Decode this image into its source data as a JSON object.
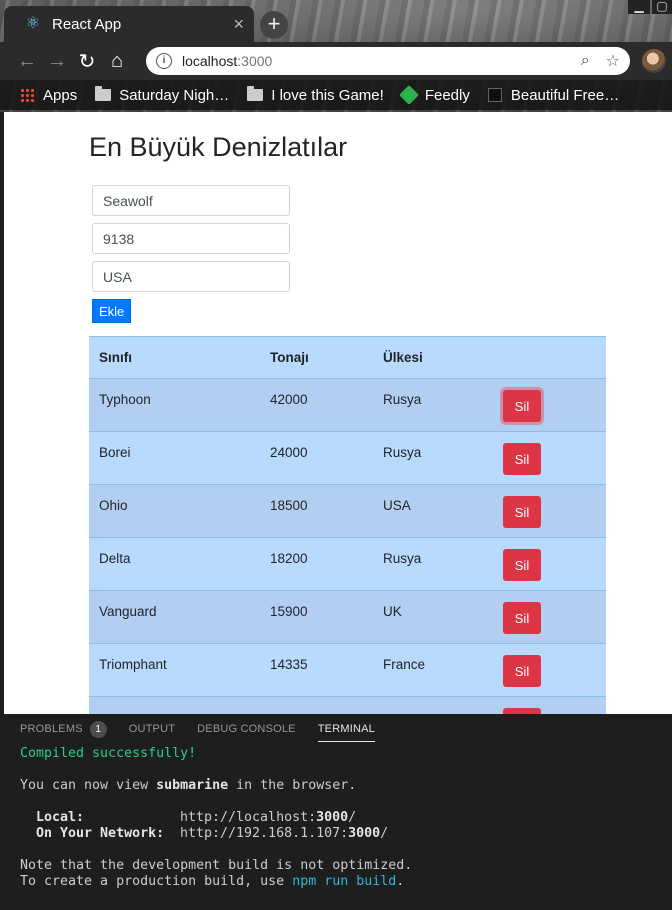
{
  "browser": {
    "tab_title": "React App",
    "tab_close": "×",
    "new_tab": "+",
    "url_host": "localhost",
    "url_port": ":3000",
    "bookmarks": [
      {
        "label": "Apps",
        "icon": "apps-grid-icon"
      },
      {
        "label": "Saturday Nigh…",
        "icon": "folder-icon"
      },
      {
        "label": "I love this Game!",
        "icon": "folder-icon"
      },
      {
        "label": "Feedly",
        "icon": "feedly-icon"
      },
      {
        "label": "Beautiful Free…",
        "icon": "bookmark-favicon-icon"
      }
    ]
  },
  "page": {
    "title": "En Büyük Denizlatılar",
    "inputs": {
      "name": "Seawolf",
      "tonnage": "9138",
      "country": "USA"
    },
    "add_label": "Ekle",
    "table": {
      "headers": [
        "Sınıfı",
        "Tonajı",
        "Ülkesi"
      ],
      "delete_label": "Sil",
      "rows": [
        {
          "cls": "Typhoon",
          "ton": "42000",
          "country": "Rusya"
        },
        {
          "cls": "Borei",
          "ton": "24000",
          "country": "Rusya"
        },
        {
          "cls": "Ohio",
          "ton": "18500",
          "country": "USA"
        },
        {
          "cls": "Delta",
          "ton": "18200",
          "country": "Rusya"
        },
        {
          "cls": "Vanguard",
          "ton": "15900",
          "country": "UK"
        },
        {
          "cls": "Triomphant",
          "ton": "14335",
          "country": "France"
        }
      ]
    }
  },
  "panel": {
    "tabs": [
      "PROBLEMS",
      "OUTPUT",
      "DEBUG CONSOLE",
      "TERMINAL"
    ],
    "problems_count": "1",
    "terminal": {
      "compiled": "Compiled successfully!",
      "view_prefix": "You can now view ",
      "app_name": "submarine",
      "view_suffix": " in the browser.",
      "local_label": "  Local:",
      "local_url_prefix": "http://localhost:",
      "local_port": "3000",
      "local_url_suffix": "/",
      "network_label": "  On Your Network:",
      "network_url_prefix": "http://192.168.1.107:",
      "network_port": "3000",
      "network_url_suffix": "/",
      "note_line": "Note that the development build is not optimized.",
      "build_prefix": "To create a production build, use ",
      "build_cmd": "npm run build",
      "build_suffix": "."
    }
  },
  "colors": {
    "primary": "#007bff",
    "danger": "#dc3545",
    "table_primary": "#b8daff",
    "terminal_green": "#23d18b",
    "terminal_cyan": "#29b8db"
  }
}
